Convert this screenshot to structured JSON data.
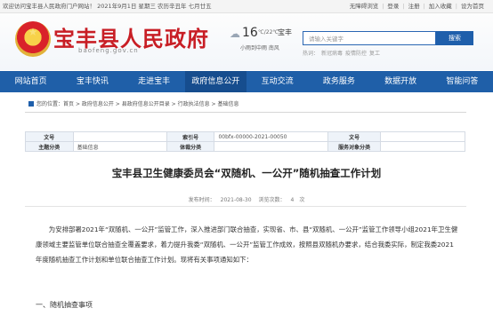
{
  "topbar": {
    "welcome": "欢迎访问宝丰县人民政府门户网站！ 2021年9月1日 星期三 农历辛丑年 七月廿五",
    "links": [
      "无障碍浏览",
      "登录",
      "注册",
      "加入收藏",
      "设为首页"
    ]
  },
  "header": {
    "site_title": "宝丰县人民政府",
    "site_domain": "baofeng.gov.cn",
    "weather": {
      "temp": "16",
      "range": "℃/22℃",
      "city": "宝丰",
      "condition": "小雨到中雨 南风"
    },
    "search": {
      "placeholder": "请输入关键字",
      "button": "搜索"
    },
    "hot": {
      "label": "热词：",
      "words": [
        "新冠病毒",
        "疫情防控",
        "复工"
      ]
    }
  },
  "nav": {
    "items": [
      "网站首页",
      "宝丰快讯",
      "走进宝丰",
      "政府信息公开",
      "互动交流",
      "政务服务",
      "数据开放",
      "智能问答"
    ]
  },
  "breadcrumb": {
    "prefix": "您的位置：",
    "items": [
      "首页",
      "政府信息公开",
      "县政府信息公开目录",
      "行政执法信息",
      "基础信息"
    ]
  },
  "info": {
    "rows": [
      {
        "k1": "文号",
        "v1": "",
        "k2": "索引号",
        "v2": "00bfx-00000-2021-00050",
        "k3": "文号",
        "v3": ""
      },
      {
        "k1": "主题分类",
        "v1": "基础信息",
        "k2": "体裁分类",
        "v2": "",
        "k3": "服务对象分类",
        "v3": ""
      }
    ]
  },
  "article": {
    "title": "宝丰县卫生健康委员会“双随机、一公开”随机抽查工作计划",
    "meta_date_label": "发布时间：",
    "meta_date": "2021-08-30",
    "meta_views_label": "浏览次数：",
    "meta_views": "4",
    "meta_sep": "次",
    "body": "为安排部署2021年“双随机、一公开”监管工作，深入推进部门联合抽查，实现省、市、县“双随机、一公开”监管工作领导小组2021年卫生健康领域主要监管单位联合抽查全覆盖要求，着力提升我委“双随机、一公开”监管工作成效，按照县双随机办要求，结合我委实际，制定我委2021年度随机抽查工作计划和单位联合抽查工作计划。现将有关事项通知如下：",
    "section1": "一、随机抽查事项"
  },
  "colors": {
    "brand_red": "#c81e25",
    "nav_blue": "#1f5fa8"
  }
}
